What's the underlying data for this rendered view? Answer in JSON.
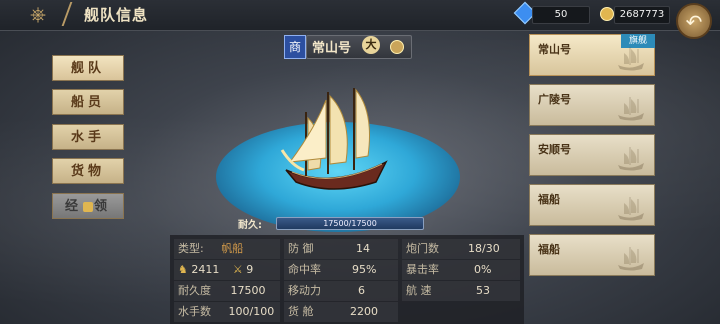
{
  "header": {
    "title": "舰队信息"
  },
  "resources": {
    "gems": "50",
    "coins": "2687773"
  },
  "menu": [
    {
      "label": "舰队",
      "active": true
    },
    {
      "label": "船员"
    },
    {
      "label": "水手"
    },
    {
      "label": "货物"
    },
    {
      "label_prefix": "经",
      "label_suffix": "领",
      "locked": true
    }
  ],
  "ship": {
    "type_badge": "商",
    "name": "常山号",
    "size_badge": "大",
    "durability_label": "耐久:",
    "durability": "17500/17500",
    "durability_fraction": 1.0
  },
  "stats": {
    "type_label": "类型:",
    "type_value": "帆船",
    "crew_value": "2411",
    "combat_value": "9",
    "durability_label": "耐久度",
    "durability_value": "17500",
    "sailors_label": "水手数",
    "sailors_value": "100/100",
    "defense_label": "防 御",
    "defense_value": "14",
    "hit_label": "命中率",
    "hit_value": "95%",
    "move_label": "移动力",
    "move_value": "6",
    "cargo_label": "货 舱",
    "cargo_value": "2200",
    "cannon_label": "炮门数",
    "cannon_value": "18/30",
    "crit_label": "暴击率",
    "crit_value": "0%",
    "speed_label": "航 速",
    "speed_value": "53"
  },
  "ship_list": [
    {
      "name": "常山号",
      "flag": "旗舰",
      "selected": true
    },
    {
      "name": "广陵号"
    },
    {
      "name": "安顺号"
    },
    {
      "name": "福船"
    },
    {
      "name": "福船"
    }
  ],
  "colors": {
    "highlight": "#d29a4a",
    "flagship_tag": "#2d8bb8",
    "sea": "#2fa8d8"
  }
}
